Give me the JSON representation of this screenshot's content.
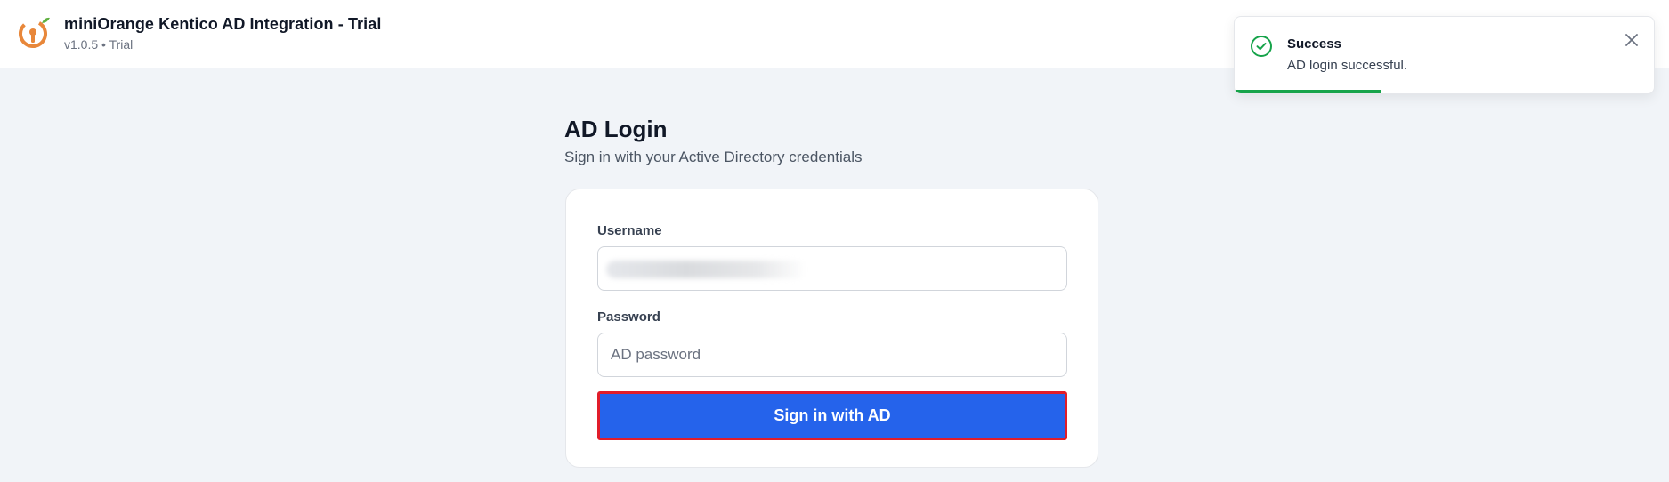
{
  "header": {
    "title": "miniOrange Kentico AD Integration - Trial",
    "version": "v1.0.5 • Trial",
    "logo_icon": "orange-key-logo-icon",
    "brand_color": "#e8873a"
  },
  "login": {
    "title": "AD Login",
    "subtitle": "Sign in with your Active Directory credentials",
    "username_label": "Username",
    "username_value": "",
    "password_label": "Password",
    "password_placeholder": "AD password",
    "submit_label": "Sign in with AD",
    "accent_color": "#2563eb"
  },
  "toast": {
    "title": "Success",
    "message": "AD login successful.",
    "icon": "check-circle-icon",
    "close_icon": "close-icon",
    "progress": 0.35,
    "status_color": "#16a34a"
  }
}
